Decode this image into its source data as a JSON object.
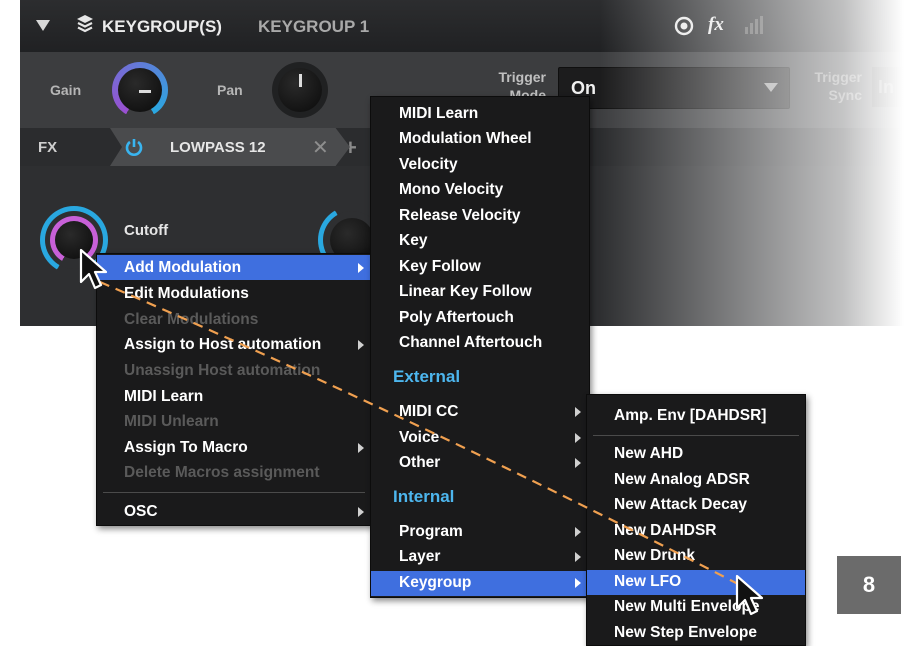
{
  "header": {
    "title": "KEYGROUP(S)",
    "subtitle": "KEYGROUP 1",
    "fx_label": "fx"
  },
  "controls": {
    "gain_label": "Gain",
    "pan_label": "Pan",
    "trigger_mode_label": "Trigger Mode",
    "trigger_mode_value": "On",
    "trigger_sync_label": "Trigger Sync",
    "trigger_sync_partial": "In"
  },
  "fx_bar": {
    "label": "FX",
    "effect_name": "LOWPASS 12"
  },
  "filter": {
    "cutoff_label": "Cutoff"
  },
  "context_menu": {
    "items": [
      {
        "label": "Add Modulation",
        "submenu": true,
        "selected": true,
        "enabled": true
      },
      {
        "label": "Edit Modulations",
        "submenu": false,
        "enabled": true
      },
      {
        "label": "Clear Modulations",
        "submenu": false,
        "enabled": false
      },
      {
        "label": "Assign to Host automation",
        "submenu": true,
        "enabled": true
      },
      {
        "label": "Unassign Host automation",
        "submenu": false,
        "enabled": false
      },
      {
        "label": "MIDI Learn",
        "submenu": false,
        "enabled": true
      },
      {
        "label": "MIDI Unlearn",
        "submenu": false,
        "enabled": false
      },
      {
        "label": "Assign To Macro",
        "submenu": true,
        "enabled": true
      },
      {
        "label": "Delete Macros assignment",
        "submenu": false,
        "enabled": false
      },
      {
        "label": "OSC",
        "submenu": true,
        "enabled": true
      }
    ]
  },
  "modulation_menu": {
    "items": [
      "MIDI Learn",
      "Modulation Wheel",
      "Velocity",
      "Mono Velocity",
      "Release Velocity",
      "Key",
      "Key Follow",
      "Linear Key Follow",
      "Poly Aftertouch",
      "Channel Aftertouch"
    ],
    "external_header": "External",
    "external_items": [
      "MIDI CC",
      "Voice",
      "Other"
    ],
    "internal_header": "Internal",
    "internal_items": [
      "Program",
      "Layer",
      "Keygroup"
    ],
    "selected": "Keygroup"
  },
  "keygroup_menu": {
    "items": [
      "Amp. Env [DAHDSR]",
      "New AHD",
      "New Analog ADSR",
      "New Attack Decay",
      "New DAHDSR",
      "New Drunk",
      "New LFO",
      "New Multi Envelope",
      "New Step Envelope"
    ],
    "selected": "New LFO"
  },
  "badge": {
    "number": "8"
  },
  "colors": {
    "selection": "#3f6fdf",
    "section_header": "#4db6ee",
    "knob_ring_blue": "#29a8e0",
    "knob_ring_purple": "#9a4fd0",
    "path_dashes": "#f0a050"
  }
}
